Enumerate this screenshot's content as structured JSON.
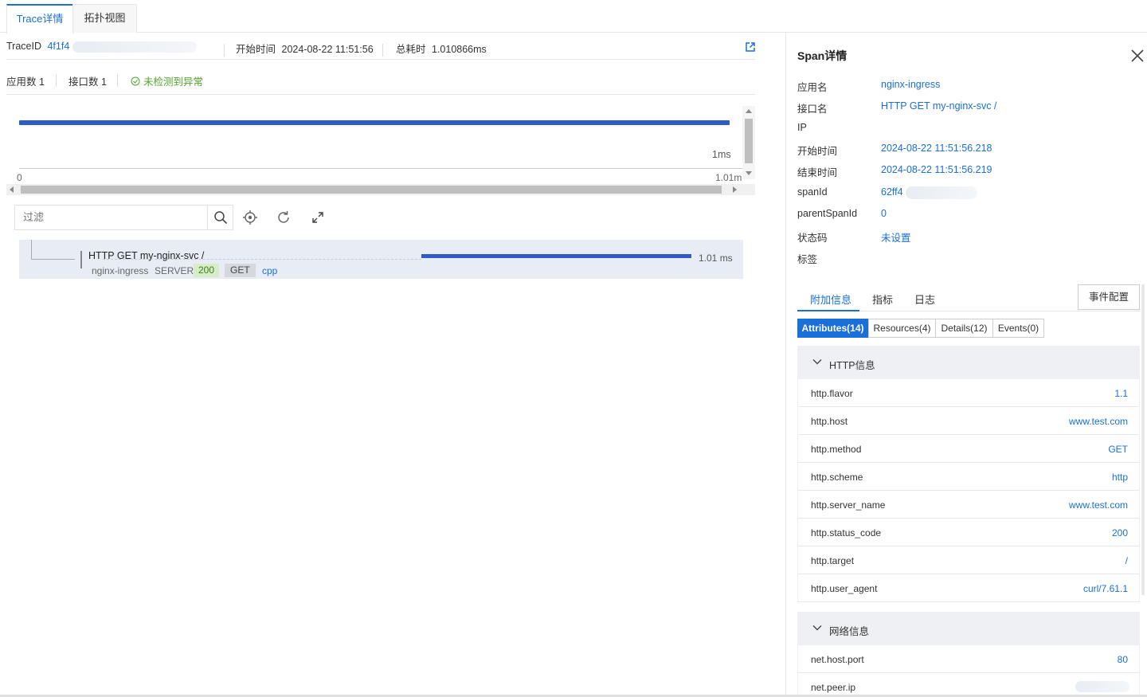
{
  "tabs": [
    "Trace详情",
    "拓扑视图"
  ],
  "trace": {
    "traceid_label": "TraceID",
    "traceid_value": "4f1f4",
    "start_label": "开始时间",
    "start_value": "2024-08-22 11:51:56",
    "duration_label": "总耗时",
    "duration_value": "1.010866ms"
  },
  "stats": {
    "apps": "应用数 1",
    "apis": "接口数 1",
    "status": "未检测到异常"
  },
  "timeline": {
    "label_1ms": "1ms",
    "axis_start": "0",
    "axis_end": "1.01m"
  },
  "toolbar": {
    "filter_placeholder": "过滤"
  },
  "span": {
    "name": "HTTP GET my-nginx-svc /",
    "app": "nginx-ingress",
    "kind": "SERVER",
    "status": "200",
    "method": "GET",
    "lang": "cpp",
    "duration": "1.01 ms"
  },
  "detail": {
    "title": "Span详情",
    "fields": [
      {
        "k": "应用名",
        "v": "nginx-ingress"
      },
      {
        "k": "接口名",
        "v": "HTTP GET my-nginx-svc /"
      },
      {
        "k": "IP",
        "v": ""
      },
      {
        "k": "开始时间",
        "v": "2024-08-22 11:51:56.218"
      },
      {
        "k": "结束时间",
        "v": "2024-08-22 11:51:56.219"
      },
      {
        "k": "spanId",
        "v": "62ff4"
      },
      {
        "k": "parentSpanId",
        "v": "0"
      },
      {
        "k": "状态码",
        "v": "未设置"
      },
      {
        "k": "标签",
        "v": ""
      }
    ],
    "subtabs": [
      "附加信息",
      "指标",
      "日志"
    ],
    "event_button": "事件配置",
    "segments": [
      "Attributes(14)",
      "Resources(4)",
      "Details(12)",
      "Events(0)"
    ],
    "http_group": "HTTP信息",
    "http_attrs": [
      {
        "k": "http.flavor",
        "v": "1.1"
      },
      {
        "k": "http.host",
        "v": "www.test.com"
      },
      {
        "k": "http.method",
        "v": "GET"
      },
      {
        "k": "http.scheme",
        "v": "http"
      },
      {
        "k": "http.server_name",
        "v": "www.test.com"
      },
      {
        "k": "http.status_code",
        "v": "200"
      },
      {
        "k": "http.target",
        "v": "/"
      },
      {
        "k": "http.user_agent",
        "v": "curl/7.61.1"
      }
    ],
    "net_group": "网络信息",
    "net_attrs": [
      {
        "k": "net.host.port",
        "v": "80"
      },
      {
        "k": "net.peer.ip",
        "v": ""
      }
    ]
  },
  "colors": {
    "accent": "#1a6fd8",
    "ok": "#52a52c",
    "bar": "#2f5bc4"
  }
}
